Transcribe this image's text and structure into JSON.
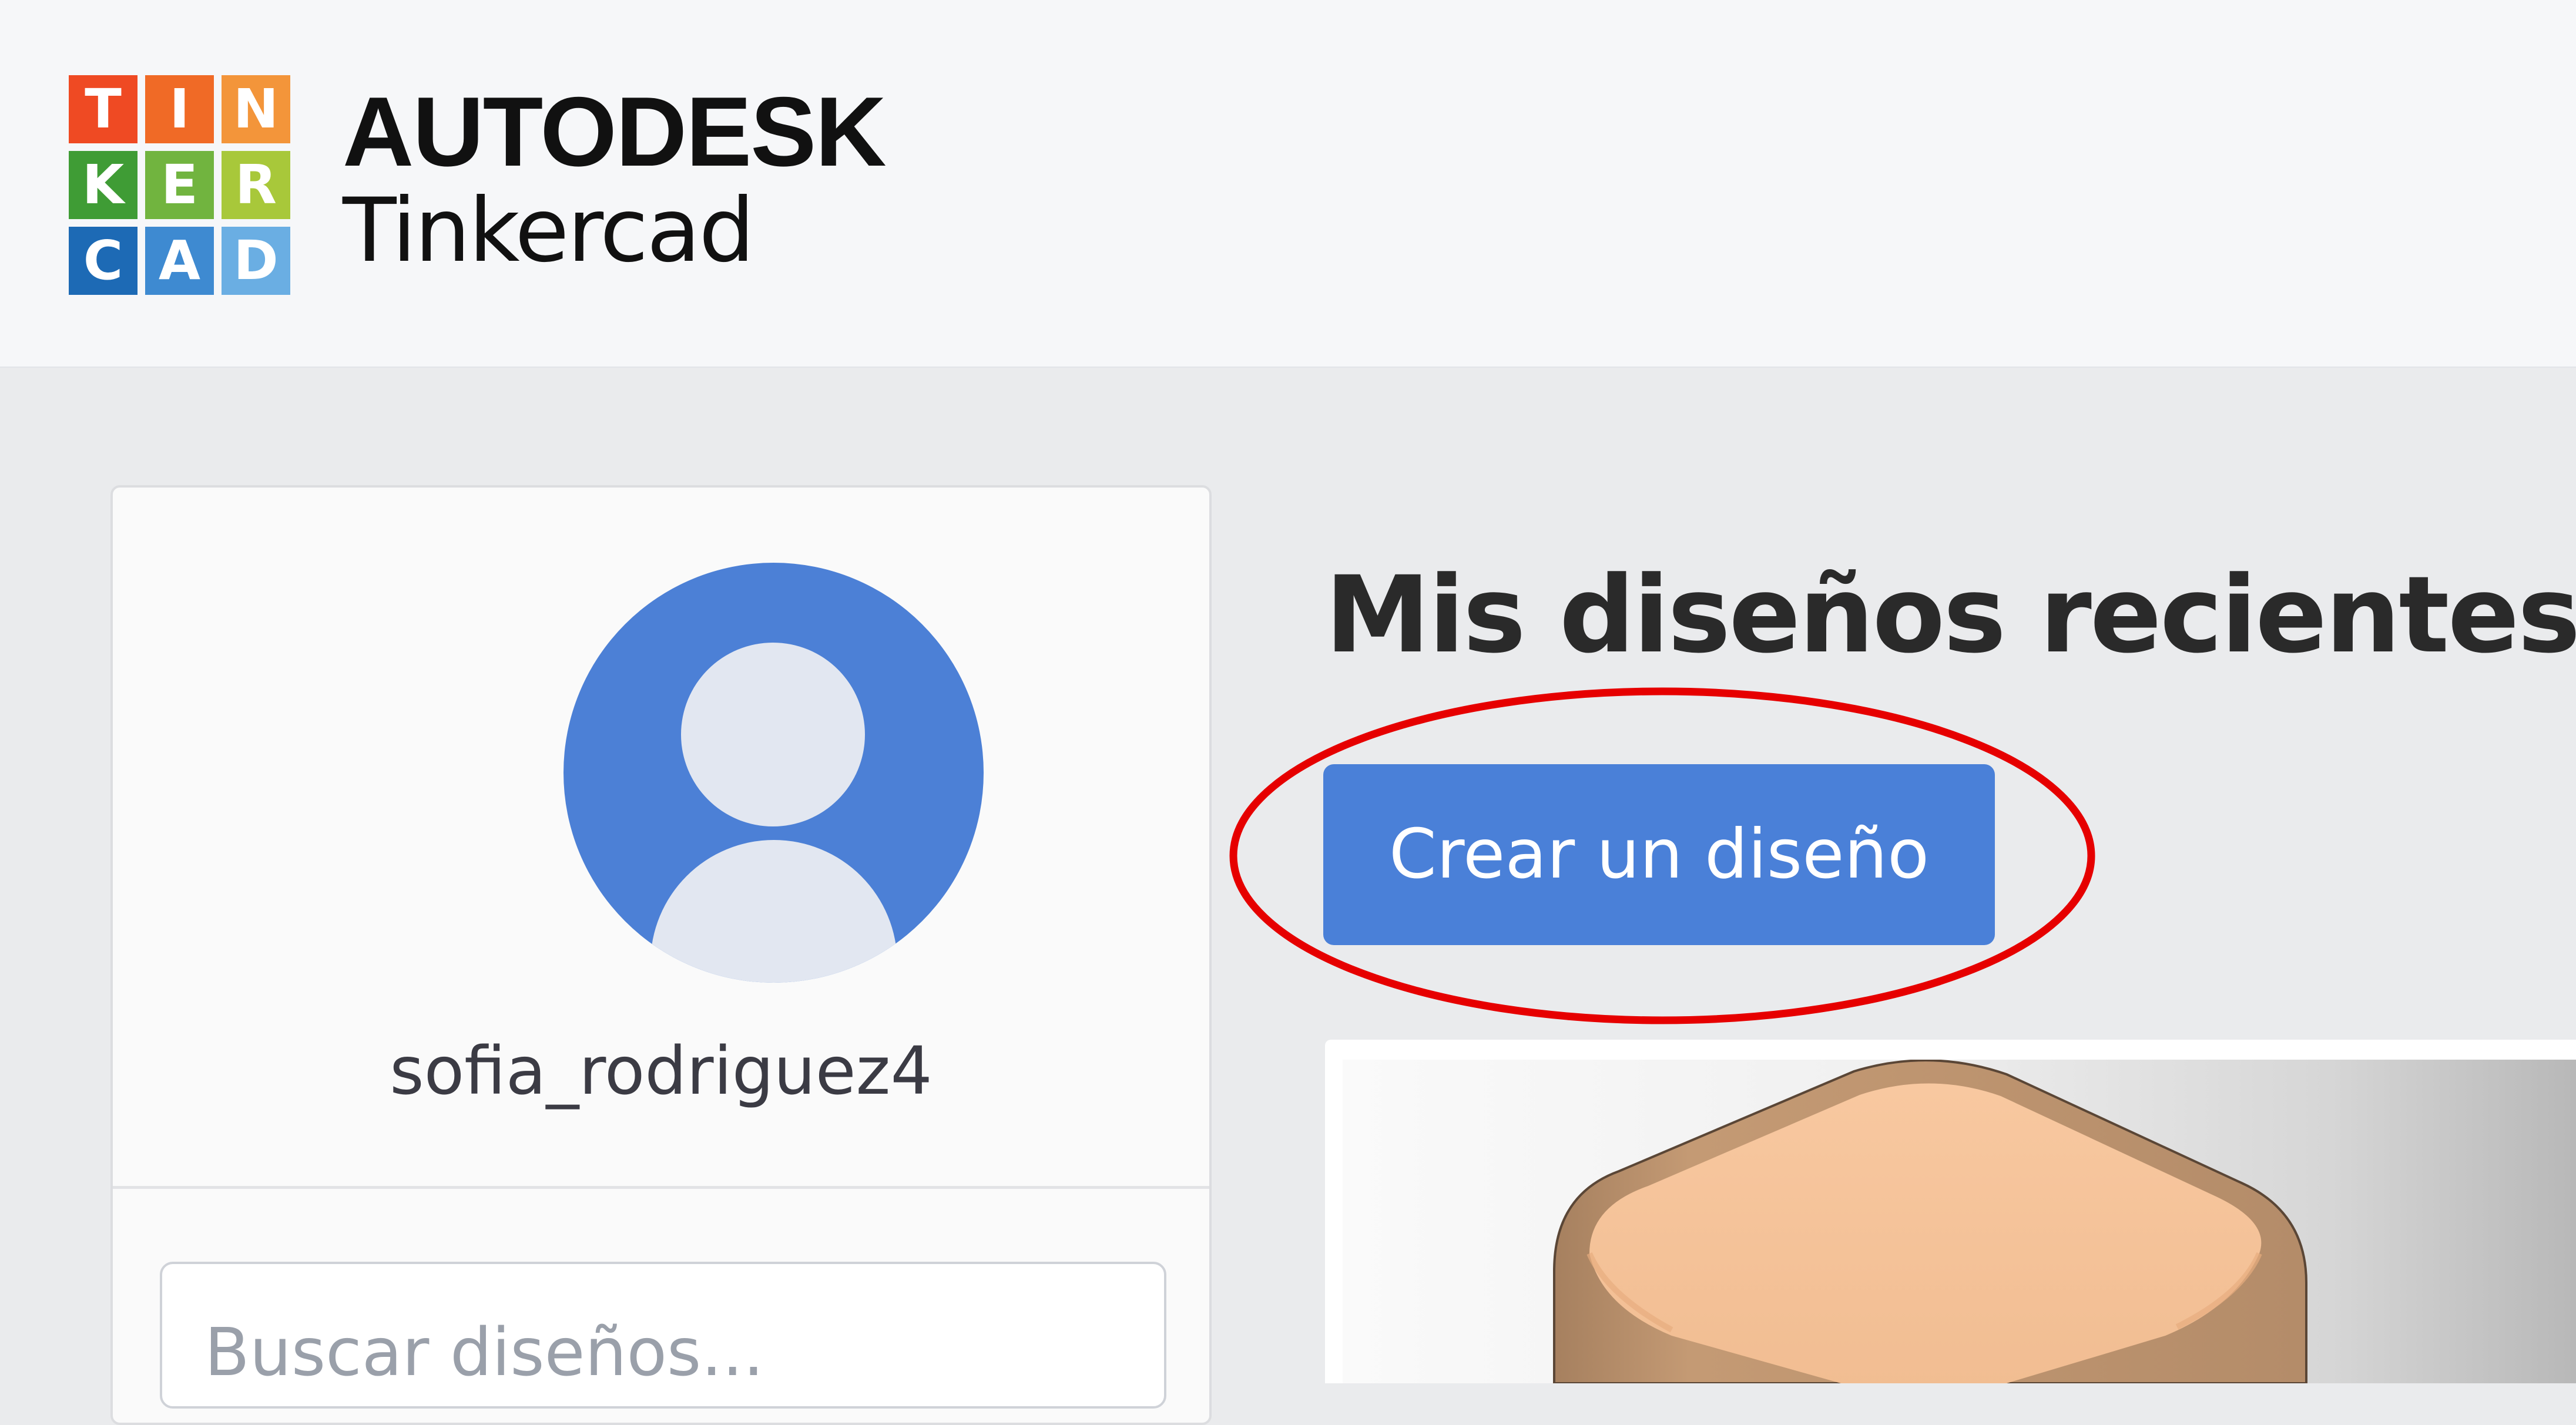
{
  "brand": {
    "logo_letters": [
      {
        "letter": "T",
        "color": "#ef4a23"
      },
      {
        "letter": "I",
        "color": "#f06a26"
      },
      {
        "letter": "N",
        "color": "#f3953a"
      },
      {
        "letter": "K",
        "color": "#3f9c35"
      },
      {
        "letter": "E",
        "color": "#71b43f"
      },
      {
        "letter": "R",
        "color": "#a8c83a"
      },
      {
        "letter": "C",
        "color": "#1d6ab5"
      },
      {
        "letter": "A",
        "color": "#3e8ad1"
      },
      {
        "letter": "D",
        "color": "#6aaee3"
      }
    ],
    "company": "AUTODESK",
    "product": "Tinkercad"
  },
  "profile": {
    "username": "sofia_rodriguez4",
    "avatar_icon": "default-user-avatar-icon",
    "avatar_color": "#4c80d6"
  },
  "search": {
    "placeholder": "Buscar diseños..."
  },
  "main": {
    "title": "Mis diseños recientes",
    "create_button_label": "Crear un diseño",
    "accent_color": "#4a80d8",
    "highlight_color": "#e60000"
  },
  "designs": [
    {
      "thumbnail_icon": "rounded-box-3d-thumbnail",
      "shape_color": "#f5c49a"
    }
  ]
}
